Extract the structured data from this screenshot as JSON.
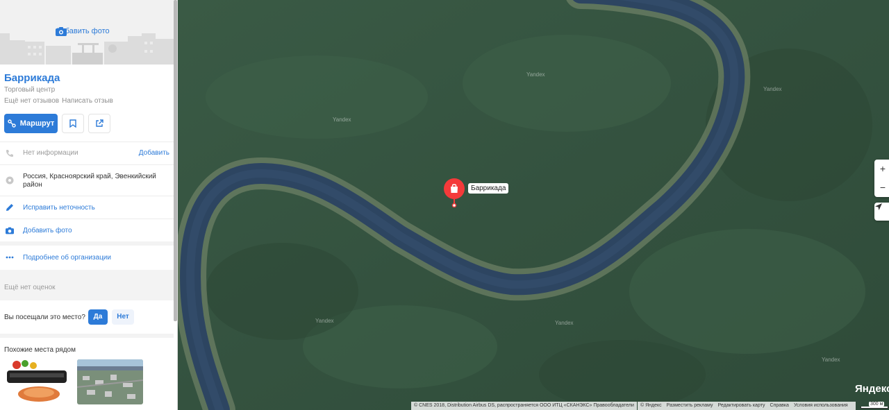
{
  "sidebar": {
    "add_photo_top": "Добавить фото",
    "title": "Баррикада",
    "category": "Торговый центр",
    "no_reviews": "Ещё нет отзывов",
    "write_review": "Написать отзыв",
    "route_label": "Маршрут",
    "phone_text": "Нет информации",
    "phone_add": "Добавить",
    "address": "Россия, Красноярский край, Эвенкийский район",
    "fix_label": "Исправить неточность",
    "add_photo": "Добавить фото",
    "more_label": "Подробнее об организации",
    "no_ratings": "Ещё нет оценок",
    "visited_question": "Вы посещали это место?",
    "yes": "Да",
    "no": "Нет",
    "similar_title": "Похожие места рядом"
  },
  "map": {
    "marker_label": "Баррикада",
    "watermark": "Yandex",
    "zoom_in": "+",
    "zoom_out": "−",
    "logo": "Яндекс",
    "copyright": "© CNES 2018, Distribution Airbus DS, распространяется ООО ИТЦ «СКАНЭКС»   Правообладатели",
    "footer_links": [
      "© Яндекс",
      "Разместить рекламу",
      "Редактировать карту",
      "Справка",
      "Условия использования"
    ],
    "scale_label": "300 м",
    "marker_color": "#f43a3a",
    "river_color": "#2d4561",
    "forest_color": "#33503c"
  },
  "colors": {
    "accent": "#2d7bd8"
  }
}
